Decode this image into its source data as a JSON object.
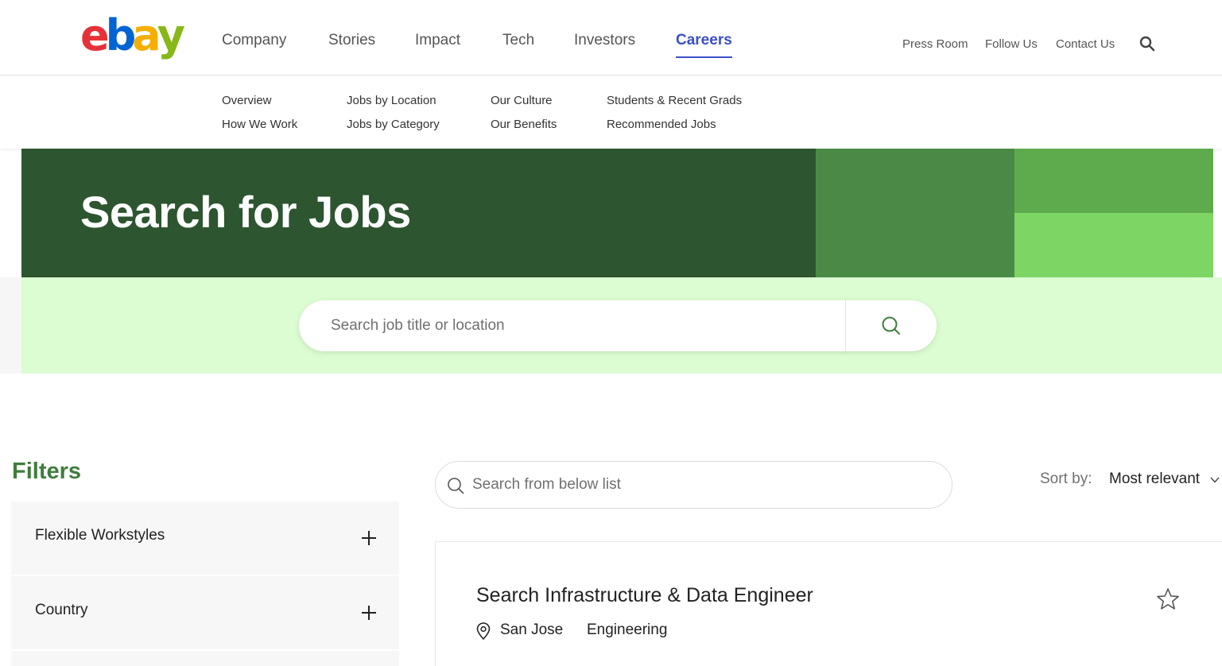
{
  "header": {
    "logo_letters": [
      "e",
      "b",
      "a",
      "y"
    ],
    "main_nav": [
      "Company",
      "Stories",
      "Impact",
      "Tech",
      "Investors",
      "Careers"
    ],
    "active_nav": "Careers",
    "utility_nav": [
      "Press Room",
      "Follow Us",
      "Contact Us"
    ],
    "search_icon": "search-icon"
  },
  "sub_nav": {
    "col1": [
      "Overview",
      "How We Work"
    ],
    "col2": [
      "Jobs by Location",
      "Jobs by Category"
    ],
    "col3": [
      "Our Culture",
      "Our Benefits"
    ],
    "col4": [
      "Students & Recent Grads",
      "Recommended Jobs"
    ]
  },
  "hero": {
    "title": "Search for Jobs",
    "search_placeholder": "Search job title or location",
    "search_button_icon": "search-icon"
  },
  "filters": {
    "title": "Filters",
    "items": [
      {
        "label": "Flexible Workstyles",
        "icon": "plus-icon"
      },
      {
        "label": "Country",
        "icon": "plus-icon"
      }
    ]
  },
  "list": {
    "search_placeholder": "Search from below list",
    "sort_label": "Sort by:",
    "sort_value": "Most relevant"
  },
  "jobs": [
    {
      "title": "Search Infrastructure & Data Engineer",
      "location": "San Jose",
      "category": "Engineering"
    }
  ],
  "colors": {
    "brand_red": "#e53238",
    "brand_blue": "#0064d2",
    "brand_yellow": "#f5af02",
    "brand_green": "#86b817",
    "active_nav": "#3a50c8",
    "hero_dark": "#2d5530",
    "hero_mid": "#4a8a46",
    "hero_light": "#5eab4e",
    "hero_lighter": "#7dd664",
    "hero_band": "#dcfcd2",
    "filters_title": "#3e7d3b"
  }
}
